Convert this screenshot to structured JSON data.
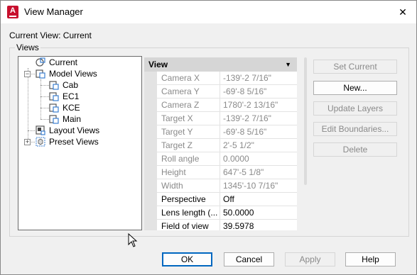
{
  "window": {
    "title": "View Manager",
    "app_icon_letter": "A",
    "close_glyph": "✕"
  },
  "current_view_label": "Current View: Current",
  "views_group_label": "Views",
  "tree": {
    "items": [
      {
        "label": "Current",
        "icon": "current-view-icon"
      },
      {
        "label": "Model Views",
        "icon": "model-views-icon",
        "expander": "−"
      },
      {
        "label": "Cab",
        "icon": "named-view-icon"
      },
      {
        "label": "EC1",
        "icon": "named-view-icon"
      },
      {
        "label": "KCE",
        "icon": "named-view-icon"
      },
      {
        "label": "Main",
        "icon": "named-view-icon"
      },
      {
        "label": "Layout Views",
        "icon": "layout-views-icon"
      },
      {
        "label": "Preset Views",
        "icon": "preset-views-icon",
        "expander": "+"
      }
    ]
  },
  "properties": {
    "header": "View",
    "header_arrow": "▼",
    "rows": [
      {
        "name": "Camera X",
        "value": "-139'-2 7/16\"",
        "disabled": true
      },
      {
        "name": "Camera Y",
        "value": "-69'-8 5/16\"",
        "disabled": true
      },
      {
        "name": "Camera Z",
        "value": "1780'-2 13/16\"",
        "disabled": true
      },
      {
        "name": "Target X",
        "value": "-139'-2 7/16\"",
        "disabled": true
      },
      {
        "name": "Target Y",
        "value": "-69'-8 5/16\"",
        "disabled": true
      },
      {
        "name": "Target Z",
        "value": "2'-5 1/2\"",
        "disabled": true
      },
      {
        "name": "Roll angle",
        "value": "0.0000",
        "disabled": true
      },
      {
        "name": "Height",
        "value": "647'-5 1/8\"",
        "disabled": true
      },
      {
        "name": "Width",
        "value": "1345'-10 7/16\"",
        "disabled": true
      },
      {
        "name": "Perspective",
        "value": "Off",
        "disabled": false
      },
      {
        "name": "Lens length (...",
        "value": "50.0000",
        "disabled": false
      },
      {
        "name": "Field of view",
        "value": "39.5978",
        "disabled": false
      }
    ]
  },
  "side_buttons": {
    "set_current": "Set Current",
    "new": "New...",
    "update_layers": "Update Layers",
    "edit_boundaries": "Edit Boundaries...",
    "delete": "Delete"
  },
  "bottom_buttons": {
    "ok": "OK",
    "cancel": "Cancel",
    "apply": "Apply",
    "help": "Help"
  },
  "colors": {
    "app_icon": "#c8102e",
    "default_button_border": "#0067c0",
    "node_icon_blue": "#3b7fd0"
  }
}
